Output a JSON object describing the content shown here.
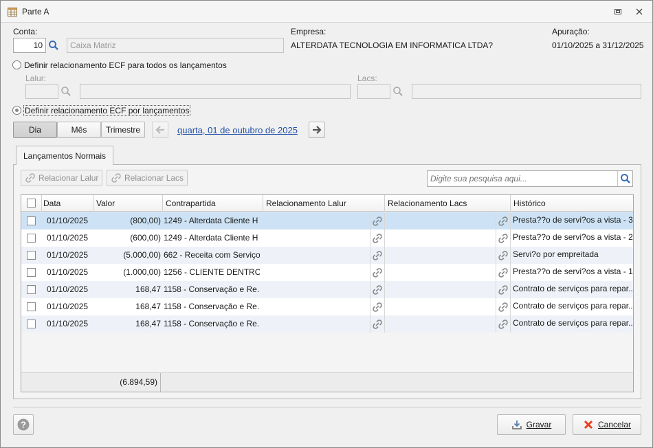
{
  "window": {
    "title": "Parte A"
  },
  "header": {
    "conta_label": "Conta:",
    "conta_value": "10",
    "conta_name": "Caixa Matriz",
    "empresa_label": "Empresa:",
    "empresa_value": "ALTERDATA TECNOLOGIA EM INFORMATICA LTDA?",
    "apuracao_label": "Apuração:",
    "apuracao_value": "01/10/2025 a 31/12/2025"
  },
  "options": {
    "radio_all_label": "Definir relacionamento ECF para todos os lançamentos",
    "lalur_label": "Lalur:",
    "lacs_label": "Lacs:",
    "radio_each_label": "Definir relacionamento ECF por lançamentos"
  },
  "period": {
    "day": "Dia",
    "month": "Mês",
    "quarter": "Trimestre",
    "active": "Dia",
    "date_text": "quarta, 01 de outubro de 2025"
  },
  "tab": {
    "label": "Lançamentos Normais"
  },
  "toolbar": {
    "relacionar_lalur": "Relacionar Lalur",
    "relacionar_lacs": "Relacionar Lacs",
    "search_placeholder": "Digite sua pesquisa aqui..."
  },
  "grid": {
    "columns": [
      "Data",
      "Valor",
      "Contrapartida",
      "Relacionamento Lalur",
      "Relacionamento Lacs",
      "Histórico"
    ],
    "rows": [
      {
        "data": "01/10/2025",
        "valor": "(800,00)",
        "contrapartida": "1249 - Alterdata Cliente H",
        "lalur": "",
        "lacs": "",
        "historico": "Presta??o de servi?os a vista - 3"
      },
      {
        "data": "01/10/2025",
        "valor": "(600,00)",
        "contrapartida": "1249 - Alterdata Cliente H",
        "lalur": "",
        "lacs": "",
        "historico": "Presta??o de servi?os a vista - 2"
      },
      {
        "data": "01/10/2025",
        "valor": "(5.000,00)",
        "contrapartida": "662 - Receita com Serviços",
        "lalur": "",
        "lacs": "",
        "historico": "Servi?o por empreitada"
      },
      {
        "data": "01/10/2025",
        "valor": "(1.000,00)",
        "contrapartida": "1256 - CLIENTE DENTRO ...",
        "lalur": "",
        "lacs": "",
        "historico": "Presta??o de servi?os a vista - 1"
      },
      {
        "data": "01/10/2025",
        "valor": "168,47",
        "contrapartida": "1158 - Conservação e Re...",
        "lalur": "",
        "lacs": "",
        "historico": "Contrato de serviços para repar..."
      },
      {
        "data": "01/10/2025",
        "valor": "168,47",
        "contrapartida": "1158 - Conservação e Re...",
        "lalur": "",
        "lacs": "",
        "historico": "Contrato de serviços para repar..."
      },
      {
        "data": "01/10/2025",
        "valor": "168,47",
        "contrapartida": "1158 - Conservação e Re...",
        "lalur": "",
        "lacs": "",
        "historico": "Contrato de serviços para repar..."
      }
    ],
    "total": "(6.894,59)"
  },
  "footer": {
    "gravar": "Gravar",
    "cancelar": "Cancelar"
  },
  "colors": {
    "selected_row": "#cde3f5",
    "row_alt": "#eef2f8",
    "row": "#ffffff",
    "link": "#1f4fa8",
    "cancel_icon": "#e8401c"
  }
}
